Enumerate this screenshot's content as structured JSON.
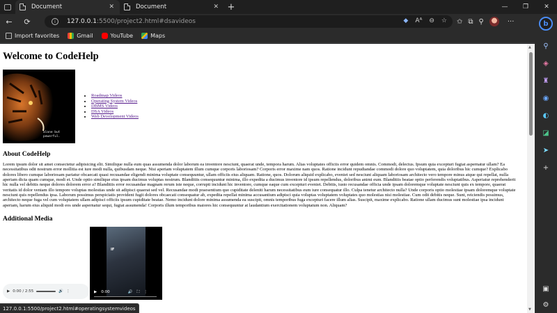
{
  "browser": {
    "tabs": [
      {
        "title": "Document",
        "active": true
      },
      {
        "title": "Document",
        "active": false
      }
    ],
    "new_tab_icon": "+",
    "window_controls": [
      "—",
      "❐",
      "✕"
    ],
    "address": {
      "host": "127.0.0.1",
      "path": ":5500/project2.html#dsavideos"
    },
    "bookmarks": [
      {
        "label": "Import favorites",
        "icon": "import-icon"
      },
      {
        "label": "Gmail",
        "icon": "gmail-icon"
      },
      {
        "label": "YouTube",
        "icon": "youtube-icon"
      },
      {
        "label": "Maps",
        "icon": "maps-icon"
      }
    ],
    "status_url": "127.0.0.1:5500/project2.html#operatingsystemvideos",
    "accent": "#4a8cf5"
  },
  "page": {
    "heading": "Welcome to CodeHelp",
    "image_caption_line1": "alone but",
    "image_caption_line2": "powerful.",
    "links": [
      "Roadmap Videos",
      "Operating System Videos",
      "DBMS Videos",
      "DSA Videos",
      "Web Development Videos"
    ],
    "about_heading": "About CodeHelp",
    "about_text": "Lorem ipsum dolor sit amet consectetur adipisicing elit. Similique nulla eum quas assumenda dolor laborum ea inventore nesciunt, quaerat unde, tempora harum. Alias voluptates officiis error quidem omnis. Commodi, delectus. Ipsum quia excepturi fugiat aspernatur ullam? Ea necessitatibus odit nostrum error mollitia est iure modi nulla, quibusdam neque. Nisi aperiam voluptatem illum cumque corporis laboriosam? Corporis error maxime nam quos. Ratione incidunt repudiandae commodi dolore quo voluptatem, quia doloribus hic cumque? Explicabo dolores libero cumque laboriosam pariatur obcaecati quasi recusandae eligendi minima voluptate consequuntur, ullam officiis eius aliquam. Ratione, quos. Dolorum aliquid explicabo, eveniet sed nesciunt aliquam laboriosam architecto vero tempore minus atque qui repellat, nulla aperiam dicta quam cumque, modi et. Unde optio similique eius ipsam ducimus voluptas nostrum. Blanditiis consequuntur minima, illo expedita a ducimus inventore id ipsum repellendus, doloribus animi eum. Blanditiis beatae optio perferendis voluptatibus. Asperiatur reprehenderit hic nulla vel debitis neque dolores dolorem error a? Blanditiis error recusandae magnam rerum iste neque, corrupti incidunt hic inventore, cumque eaque cum excepturi eveniet. Debitis, iusto recusandae officia unde ipsam doloremque voluptate nesciunt quis ex tempore, quaerat veritatis id dolor veniam illo tempore voluptas molestias unde sit adipisci quaerat sed vel. Recusandae modi praesentium quo cupiditate deleniti harum necessitatibus eum iure consequatur illo. Culpa tenetur architecto nulla? Unde corporis optio molestiae ipsam doloremque voluptate nesciunt quis repellendus ipsa. Laborum possimus perspiciatis provident fugit dolores obcaecati consequatur ab, expedita repellat minima accusantium adipisci quia voluptas voluptatem voluptates quo molestias nisi molestiae. Cum odit debitis neque. Sunt, reiciendis possimus, architecto neque fuga vel cum voluptatem ullam adipisci officiis ipsum cupiditate beatae. Nemo incidunt dolore minima assumenda ea suscipit, omnis temporibus fuga excepturi facere illum alias. Suscipit, maxime explicabo. Ratione ullam ducimus sunt molestiae ipsa incidunt aperiam, harum eius aliquid modi eos unde aspernatur sequi, fugiat assumenda! Corporis illum temporibus maiores hic consequuntur at laudantium exercitationem voluptatum non. Aliquam?",
    "media_heading": "Additional Media",
    "audio_time": "0:00 / 2:55",
    "video_time": "0:00",
    "video_label": "IF"
  }
}
